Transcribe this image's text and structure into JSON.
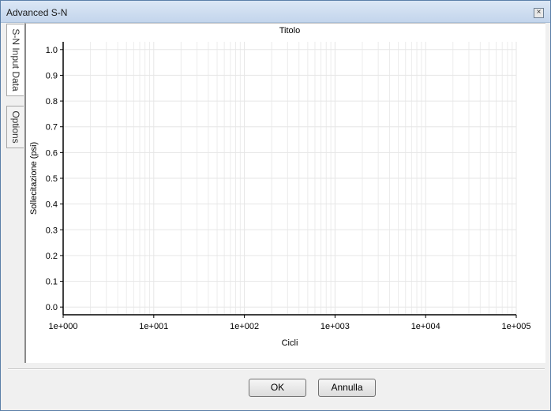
{
  "window": {
    "title": "Advanced S-N"
  },
  "tabs": [
    {
      "label": "S-N Input Data",
      "active": true
    },
    {
      "label": "Options",
      "active": false
    }
  ],
  "buttons": {
    "ok": "OK",
    "cancel": "Annulla"
  },
  "chart_data": {
    "type": "line",
    "title": "Titolo",
    "xlabel": "Cicli",
    "ylabel": "Sollecitazione (psi)",
    "x_scale": "log",
    "xlim": [
      1,
      100000
    ],
    "ylim": [
      -0.03,
      1.03
    ],
    "x_ticks": [
      "1e+000",
      "1e+001",
      "1e+002",
      "1e+003",
      "1e+004",
      "1e+005"
    ],
    "y_ticks": [
      "0.0",
      "0.1",
      "0.2",
      "0.3",
      "0.4",
      "0.5",
      "0.6",
      "0.7",
      "0.8",
      "0.9",
      "1.0"
    ],
    "series": [],
    "grid": true
  }
}
